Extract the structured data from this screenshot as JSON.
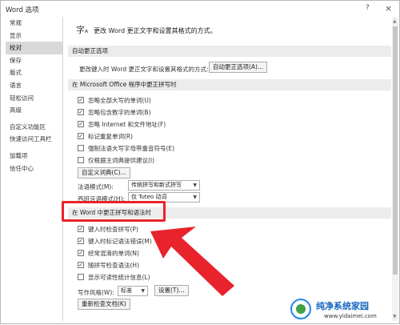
{
  "window": {
    "title": "Word 选项",
    "help": "?",
    "close": "×"
  },
  "sidebar": {
    "items": [
      {
        "label": "常规"
      },
      {
        "label": "显示"
      },
      {
        "label": "校对",
        "active": true
      },
      {
        "label": "保存"
      },
      {
        "label": "版式"
      },
      {
        "label": "语言"
      },
      {
        "label": "轻松访问"
      },
      {
        "label": "高级"
      },
      {
        "label": "自定义功能区"
      },
      {
        "label": "快速访问工具栏"
      },
      {
        "label": "加载项"
      },
      {
        "label": "信任中心"
      }
    ]
  },
  "header": {
    "text": "更改 Word 更正文字和设置其格式的方式。"
  },
  "autocorrect": {
    "section": "自动更正选项",
    "desc": "更改键入时 Word 更正文字和设置其格式的方式:",
    "button": "自动更正选项(A)..."
  },
  "office_section": {
    "title": "在 Microsoft Office 程序中更正拼写时",
    "options": [
      {
        "label": "忽略全部大写的单词(U)",
        "checked": true
      },
      {
        "label": "忽略包含数字的单词(B)",
        "checked": true
      },
      {
        "label": "忽略 Internet 和文件地址(F)",
        "checked": true
      },
      {
        "label": "标记重复单词(R)",
        "checked": true
      },
      {
        "label": "强制法语大写字母带重音符号(E)",
        "checked": false
      },
      {
        "label": "仅根据主词典提供建议(I)",
        "checked": false
      }
    ],
    "dict_button": "自定义词典(C)...",
    "french_label": "法语模式(M):",
    "french_value": "传统拼写和新式拼写",
    "spanish_label": "西班牙语模式(H):",
    "spanish_value": "仅 Tuteo 动词"
  },
  "word_section": {
    "title": "在 Word 中更正拼写和语法时",
    "options": [
      {
        "label": "键入时检查拼写(P)",
        "checked": true
      },
      {
        "label": "键入时标记语法错误(M)",
        "checked": true
      },
      {
        "label": "经常混淆的单词(N)",
        "checked": true
      },
      {
        "label": "随拼写检查语法(H)",
        "checked": true
      },
      {
        "label": "显示可读性统计信息(L)",
        "checked": false
      }
    ],
    "style_label": "写作风格(W):",
    "style_value": "标准",
    "settings_button": "设置(T)...",
    "recheck_button": "重新检查文档(K)"
  },
  "watermark": {
    "title": "纯净系统家园",
    "url": "www.yidaimei.com"
  },
  "colors": {
    "highlight": "#e8232c",
    "section_bg": "#ececec",
    "active_item": "#d8d8d8"
  }
}
